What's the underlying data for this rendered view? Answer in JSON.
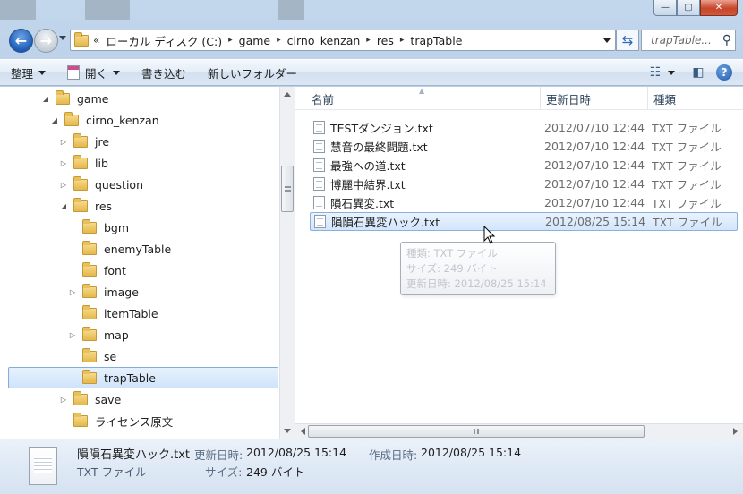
{
  "window": {
    "minimize_glyph": "—",
    "maximize_glyph": "▢",
    "close_glyph": "✕"
  },
  "address": {
    "overflow": "«",
    "crumbs": [
      "ローカル ディスク (C:)",
      "game",
      "cirno_kenzan",
      "res",
      "trapTable"
    ],
    "search_placeholder": "trapTable..."
  },
  "toolbar": {
    "organize": "整理",
    "open": "開く",
    "write": "書き込む",
    "new_folder": "新しいフォルダー"
  },
  "tree": [
    {
      "label": "game",
      "expander": "◢",
      "expanded": true
    },
    {
      "label": "cirno_kenzan",
      "expander": "◢",
      "expanded": true
    },
    {
      "label": "jre",
      "expander": "▷"
    },
    {
      "label": "lib",
      "expander": "▷"
    },
    {
      "label": "question",
      "expander": "▷"
    },
    {
      "label": "res",
      "expander": "◢",
      "expanded": true
    },
    {
      "label": "bgm",
      "expander": ""
    },
    {
      "label": "enemyTable",
      "expander": ""
    },
    {
      "label": "font",
      "expander": ""
    },
    {
      "label": "image",
      "expander": "▷"
    },
    {
      "label": "itemTable",
      "expander": ""
    },
    {
      "label": "map",
      "expander": "▷"
    },
    {
      "label": "se",
      "expander": ""
    },
    {
      "label": "trapTable",
      "expander": "",
      "selected": true
    },
    {
      "label": "save",
      "expander": "▷"
    },
    {
      "label": "ライセンス原文",
      "expander": ""
    }
  ],
  "columns": {
    "name": "名前",
    "modified": "更新日時",
    "type": "種類"
  },
  "files": [
    {
      "name": "TESTダンジョン.txt",
      "modified": "2012/07/10 12:44",
      "type": "TXT ファイル"
    },
    {
      "name": "慧音の最終問題.txt",
      "modified": "2012/07/10 12:44",
      "type": "TXT ファイル"
    },
    {
      "name": "最強への道.txt",
      "modified": "2012/07/10 12:44",
      "type": "TXT ファイル"
    },
    {
      "name": "博麗中結界.txt",
      "modified": "2012/07/10 12:44",
      "type": "TXT ファイル"
    },
    {
      "name": "隕石異変.txt",
      "modified": "2012/07/10 12:44",
      "type": "TXT ファイル"
    },
    {
      "name": "隕隕石異変ハック.txt",
      "modified": "2012/08/25 15:14",
      "type": "TXT ファイル",
      "selected": true
    }
  ],
  "tooltip": {
    "type_line": "種類: TXT ファイル",
    "size_line": "サイズ: 249 バイト",
    "date_line": "更新日時: 2012/08/25 15:14"
  },
  "details": {
    "filename": "隕隕石異変ハック.txt",
    "filetype": "TXT ファイル",
    "modified_label": "更新日時:",
    "modified_value": "2012/08/25 15:14",
    "created_label": "作成日時:",
    "created_value": "2012/08/25 15:14",
    "size_label": "サイズ:",
    "size_value": "249 バイト"
  }
}
